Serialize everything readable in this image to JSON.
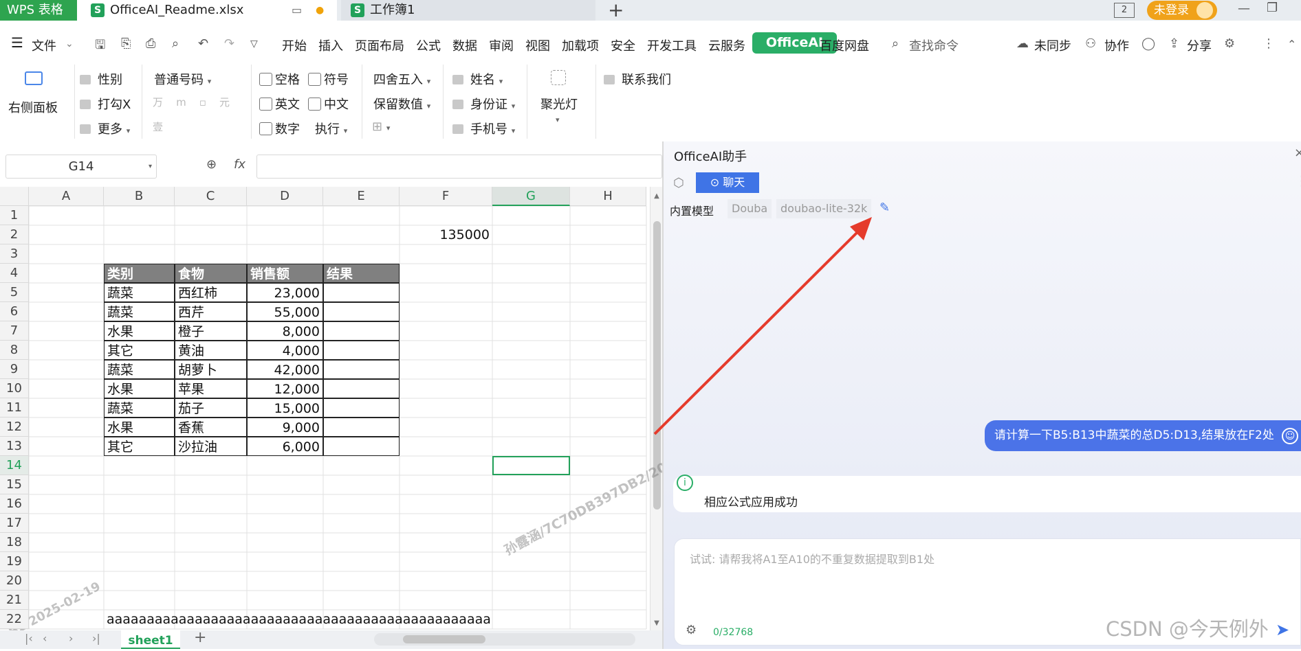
{
  "titlebar": {
    "app": "WPS 表格",
    "tab1": "OfficeAI_Readme.xlsx",
    "tab2": "工作簿1",
    "add": "+",
    "login": "未登录",
    "badge": "2"
  },
  "menu": {
    "file": "文件",
    "items": [
      "开始",
      "插入",
      "页面布局",
      "公式",
      "数据",
      "审阅",
      "视图",
      "加载项",
      "安全",
      "开发工具",
      "云服务",
      "OfficeAI",
      "百度网盘"
    ],
    "search": "查找命令",
    "sync": "未同步",
    "collab": "协作",
    "share": "分享"
  },
  "ribbon": {
    "right_panel": "右侧面板",
    "gender": "性别",
    "tick_x": "打勾X",
    "more": "更多",
    "number_format": "普通号码",
    "space": "空格",
    "symbol": "符号",
    "english": "英文",
    "chinese": "中文",
    "digit": "数字",
    "execute": "执行",
    "round": "四舍五入",
    "keep_value": "保留数值",
    "name": "姓名",
    "id_card": "身份证",
    "phone": "手机号",
    "spotlight": "聚光灯",
    "contact": "联系我们"
  },
  "formula": {
    "cell_ref": "G14",
    "fx": "fx",
    "value": ""
  },
  "sheet": {
    "columns": [
      "A",
      "B",
      "C",
      "D",
      "E",
      "F",
      "G",
      "H"
    ],
    "rows": [
      "1",
      "2",
      "3",
      "4",
      "5",
      "6",
      "7",
      "8",
      "9",
      "10",
      "11",
      "12",
      "13",
      "14",
      "15",
      "16",
      "17",
      "18",
      "19",
      "20",
      "21",
      "22"
    ],
    "f2": "135000",
    "header": [
      "类别",
      "食物",
      "销售额",
      "结果"
    ],
    "data": [
      [
        "蔬菜",
        "西红柿",
        "23,000"
      ],
      [
        "蔬菜",
        "西芹",
        "55,000"
      ],
      [
        "水果",
        "橙子",
        "8,000"
      ],
      [
        "其它",
        "黄油",
        "4,000"
      ],
      [
        "蔬菜",
        "胡萝卜",
        "42,000"
      ],
      [
        "水果",
        "苹果",
        "12,000"
      ],
      [
        "蔬菜",
        "茄子",
        "15,000"
      ],
      [
        "水果",
        "香蕉",
        "9,000"
      ],
      [
        "其它",
        "沙拉油",
        "6,000"
      ]
    ],
    "b22": "aaaaaaaaaaaaaaaaaaaaaaaaaaaaaaaaaaaaaaaaaaaaaaaa",
    "tab": "sheet1",
    "watermark1": "孙露涵/7C70DB397DB2/2025-02-19",
    "watermark2": "DB2/2025-02-19"
  },
  "panel": {
    "title": "OfficeAI助手",
    "chat_btn": "聊天",
    "model_label": "内置模型",
    "model_provider": "Douba",
    "model_name": "doubao-lite-32k",
    "user_msg": "请计算一下B5:B13中蔬菜的总D5:D13,结果放在F2处",
    "ai_msg": "相应公式应用成功",
    "input_placeholder": "试试: 请帮我将A1至A10的不重复数据提取到B1处",
    "counter": "0/32768",
    "watermark": "CSDN @今天例外"
  },
  "colors": {
    "accent_green": "#2aae67",
    "excel_green": "#22a15a",
    "chat_blue": "#4b73e8",
    "arrow_red": "#e53b2c",
    "table_header": "#808080"
  }
}
